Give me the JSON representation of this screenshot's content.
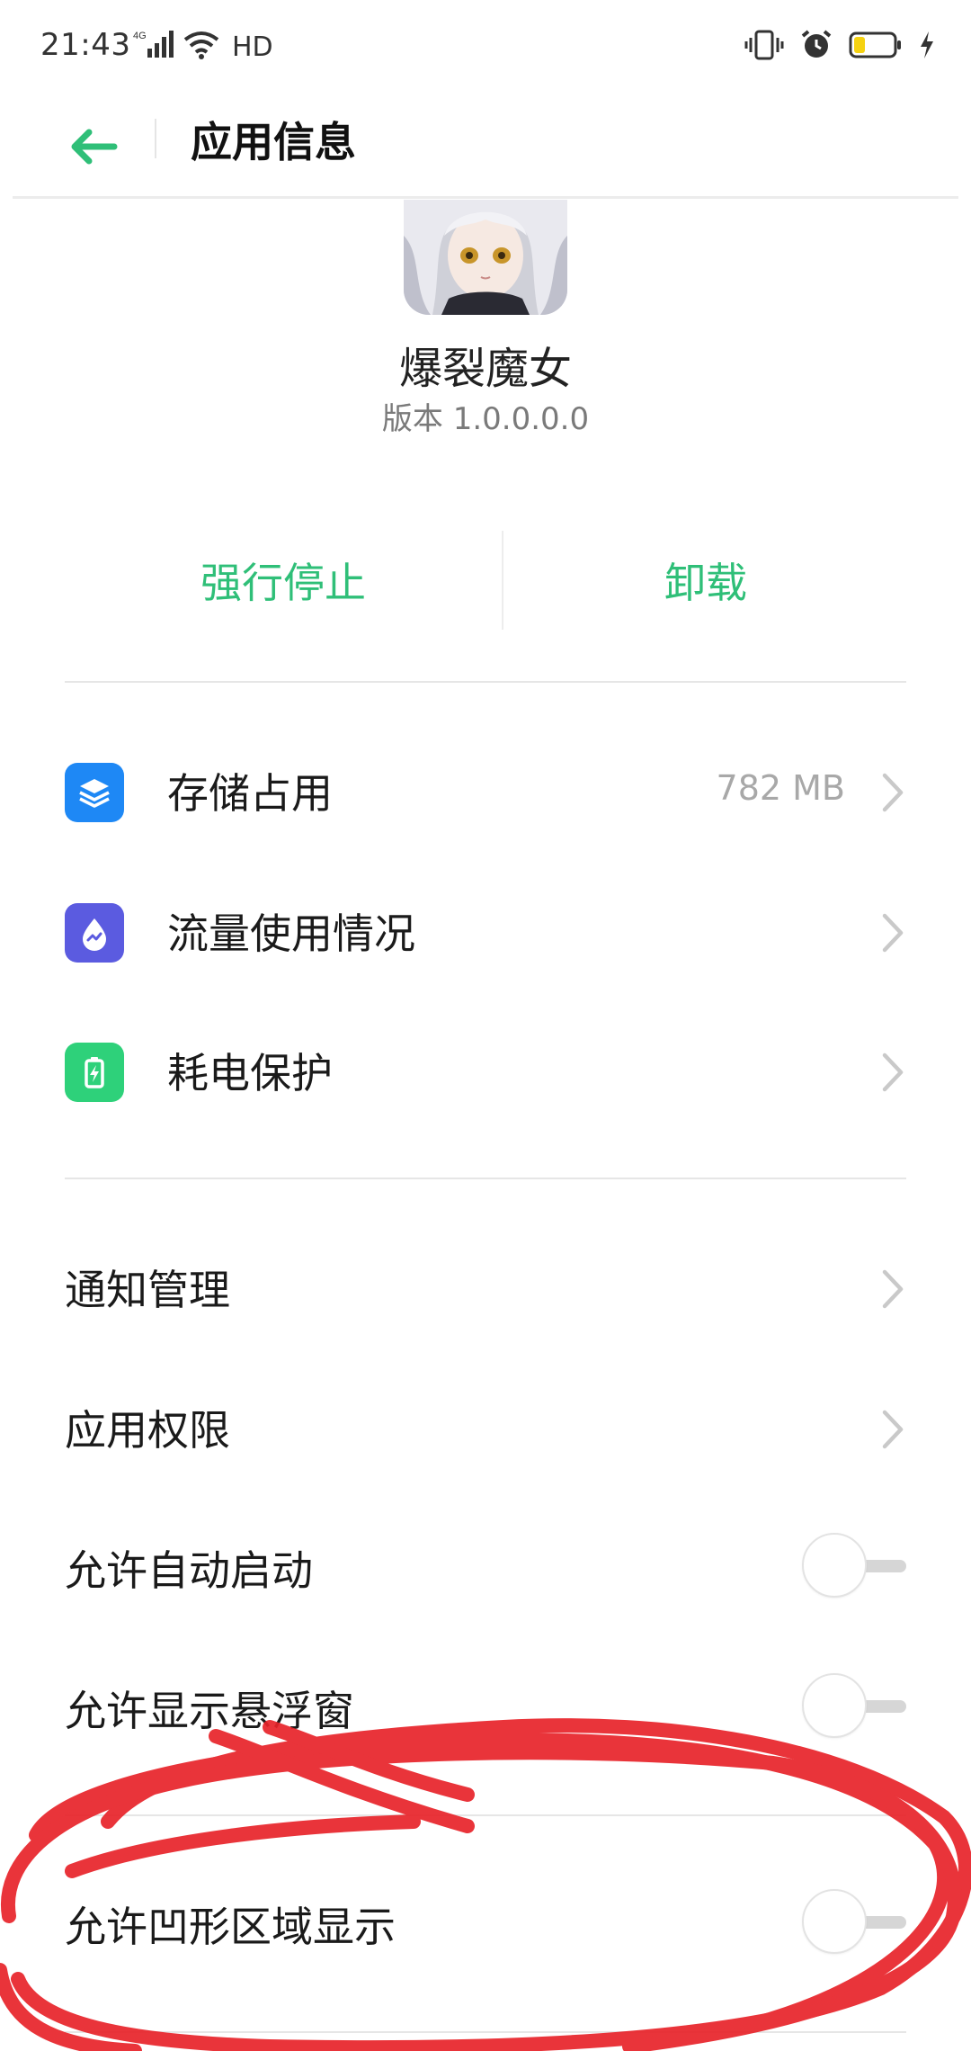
{
  "status_bar": {
    "time": "21:43",
    "network": "4G",
    "hd": "HD",
    "icons": [
      "signal-icon",
      "wifi-icon",
      "vibrate-icon",
      "alarm-icon",
      "battery-icon",
      "charging-icon"
    ]
  },
  "header": {
    "back_icon": "back-arrow-icon",
    "title": "应用信息"
  },
  "app": {
    "name": "爆裂魔女",
    "version": "版本 1.0.0.0.0"
  },
  "actions": {
    "force_stop": "强行停止",
    "uninstall": "卸载"
  },
  "detail_rows": [
    {
      "label": "存储占用",
      "value": "782 MB",
      "icon": "storage-icon",
      "icon_color": "#1e88f5"
    },
    {
      "label": "流量使用情况",
      "value": "",
      "icon": "data-usage-icon",
      "icon_color": "#5b5be0"
    },
    {
      "label": "耗电保护",
      "value": "",
      "icon": "battery-protect-icon",
      "icon_color": "#2ed17a"
    }
  ],
  "setting_rows": [
    {
      "label": "通知管理",
      "type": "link"
    },
    {
      "label": "应用权限",
      "type": "link"
    },
    {
      "label": "允许自动启动",
      "type": "toggle",
      "on": false
    },
    {
      "label": "允许显示悬浮窗",
      "type": "toggle",
      "on": false
    },
    {
      "label": "允许凹形区域显示",
      "type": "toggle",
      "on": false
    }
  ],
  "colors": {
    "accent": "#2fbf78",
    "annotation": "#e8232a"
  }
}
